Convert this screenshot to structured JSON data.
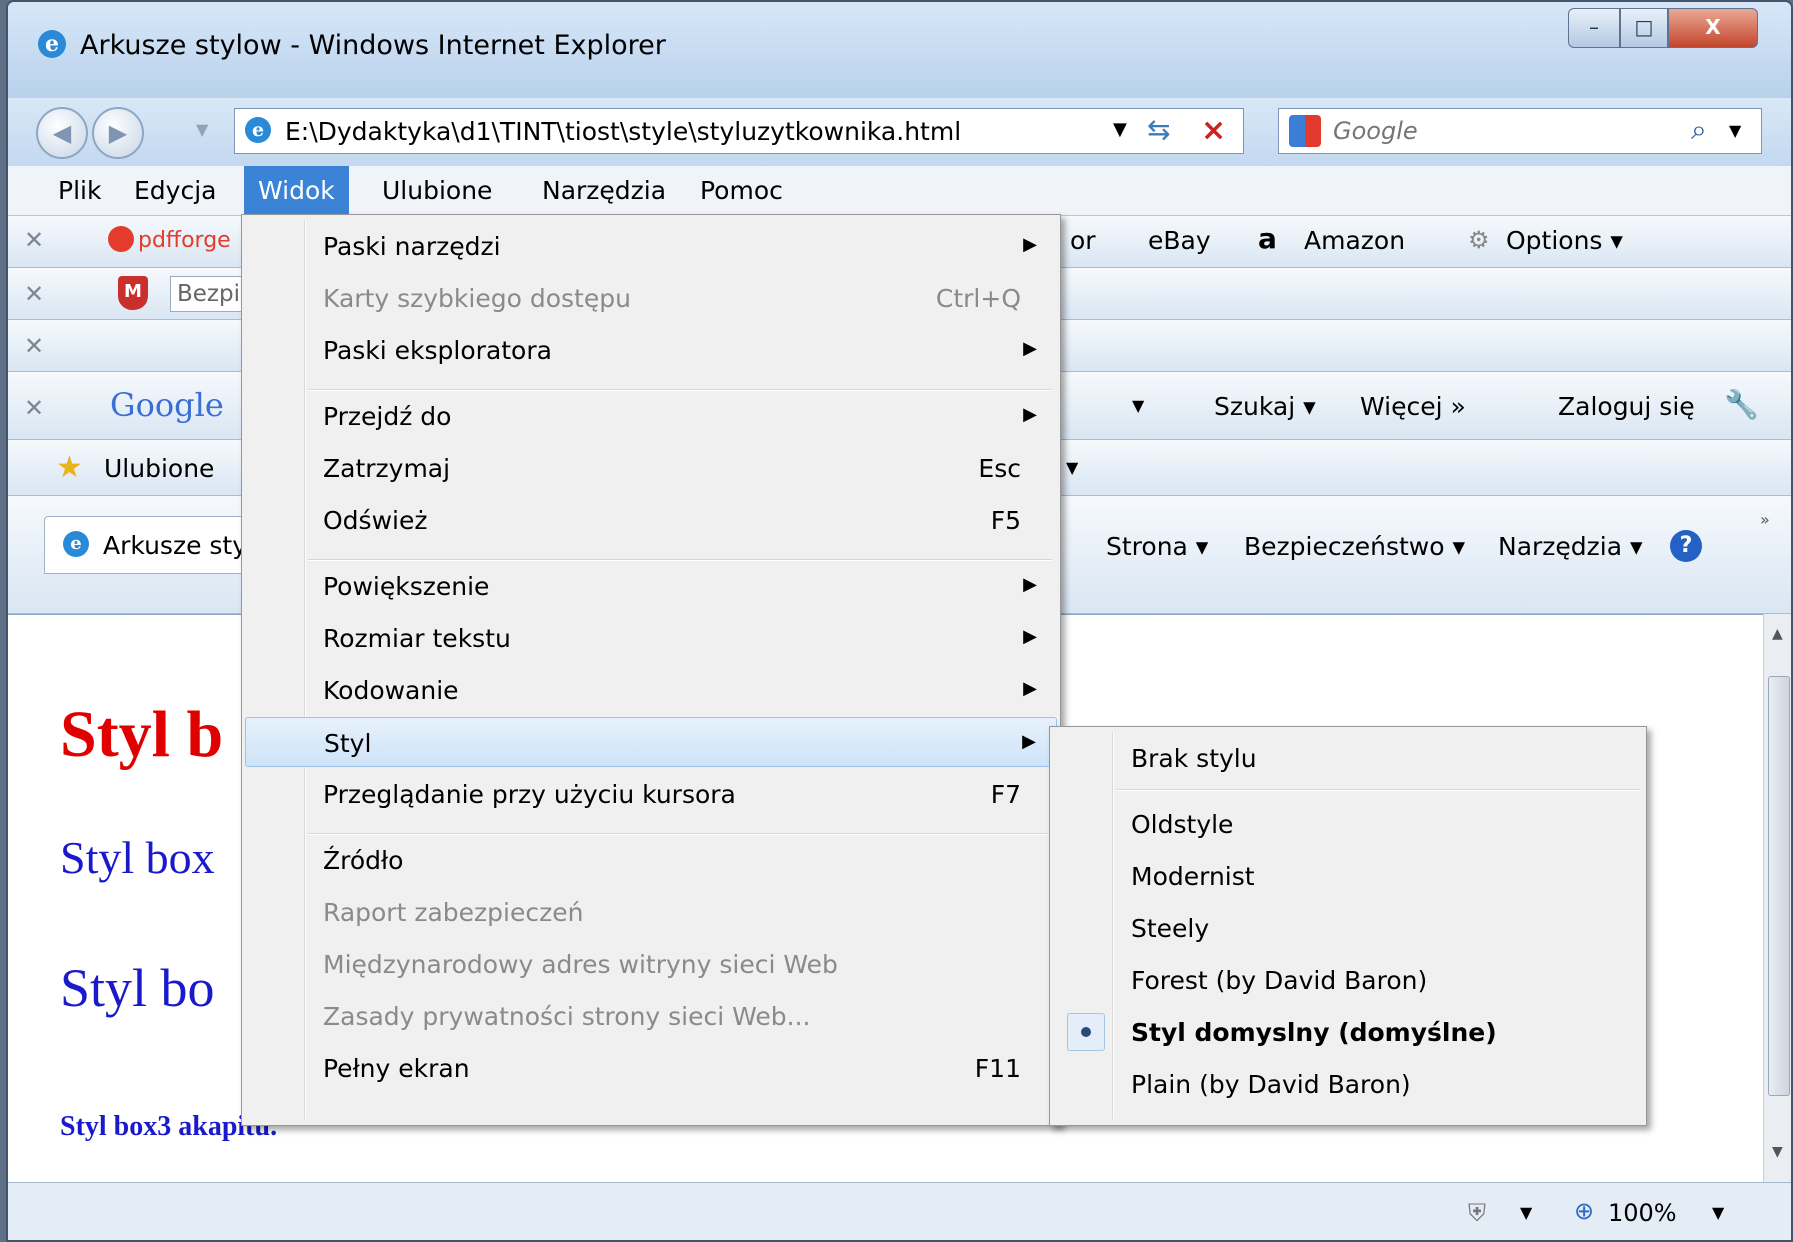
{
  "window": {
    "title": "Arkusze stylow - Windows Internet Explorer",
    "controls": {
      "minimize": "–",
      "maximize": "□",
      "close": "X"
    }
  },
  "nav": {
    "address": "E:\\Dydaktyka\\d1\\TINT\\tiost\\style\\styluzytkownika.html",
    "search_placeholder": "Google"
  },
  "menubar": [
    "Plik",
    "Edycja",
    "Widok",
    "Ulubione",
    "Narzędzia",
    "Pomoc"
  ],
  "toolbars": {
    "pdfforge": "pdfforge",
    "ebay": "eBay",
    "amazon": "Amazon",
    "options": "Options ▾",
    "partial_or": "or",
    "mcafee_field": "Bezpi",
    "google_logo": "Google",
    "szukaj": "Szukaj ▾",
    "wiecej": "Więcej »",
    "zaloguj": "Zaloguj się",
    "favorites": "Ulubione",
    "tab_title": "Arkusze sty",
    "strona": "Strona ▾",
    "bezpieczenstwo": "Bezpieczeństwo ▾",
    "narzedzia": "Narzędzia ▾"
  },
  "page_text": {
    "line1": "Styl b",
    "line2": "Styl box",
    "line3": "Styl bo",
    "line4": "Styl box3 akapitu."
  },
  "status": {
    "zoom": "100%"
  },
  "view_menu": [
    {
      "label": "Paski narzędzi",
      "shortcut": "",
      "submenu": true,
      "disabled": false
    },
    {
      "label": "Karty szybkiego dostępu",
      "shortcut": "Ctrl+Q",
      "submenu": false,
      "disabled": true
    },
    {
      "label": "Paski eksploratora",
      "shortcut": "",
      "submenu": true,
      "disabled": false
    },
    {
      "label": "Przejdź do",
      "shortcut": "",
      "submenu": true,
      "disabled": false
    },
    {
      "label": "Zatrzymaj",
      "shortcut": "Esc",
      "submenu": false,
      "disabled": false
    },
    {
      "label": "Odśwież",
      "shortcut": "F5",
      "submenu": false,
      "disabled": false
    },
    {
      "label": "Powiększenie",
      "shortcut": "",
      "submenu": true,
      "disabled": false
    },
    {
      "label": "Rozmiar tekstu",
      "shortcut": "",
      "submenu": true,
      "disabled": false
    },
    {
      "label": "Kodowanie",
      "shortcut": "",
      "submenu": true,
      "disabled": false
    },
    {
      "label": "Styl",
      "shortcut": "",
      "submenu": true,
      "disabled": false
    },
    {
      "label": "Przeglądanie przy użyciu kursora",
      "shortcut": "F7",
      "submenu": false,
      "disabled": false
    },
    {
      "label": "Źródło",
      "shortcut": "",
      "submenu": false,
      "disabled": false
    },
    {
      "label": "Raport zabezpieczeń",
      "shortcut": "",
      "submenu": false,
      "disabled": true
    },
    {
      "label": "Międzynarodowy adres witryny sieci Web",
      "shortcut": "",
      "submenu": false,
      "disabled": true
    },
    {
      "label": "Zasady prywatności strony sieci Web...",
      "shortcut": "",
      "submenu": false,
      "disabled": true
    },
    {
      "label": "Pełny ekran",
      "shortcut": "F11",
      "submenu": false,
      "disabled": false
    }
  ],
  "style_submenu": [
    {
      "label": "Brak stylu",
      "selected": false
    },
    {
      "label": "Oldstyle",
      "selected": false
    },
    {
      "label": "Modernist",
      "selected": false
    },
    {
      "label": "Steely",
      "selected": false
    },
    {
      "label": "Forest (by David Baron)",
      "selected": false
    },
    {
      "label": "Styl domyslny (domyślne)",
      "selected": true
    },
    {
      "label": "Plain (by David Baron)",
      "selected": false
    }
  ],
  "colors": {
    "menu_active": "#3b83d6",
    "page_red": "#e00000",
    "page_blue": "#1a1acc"
  }
}
